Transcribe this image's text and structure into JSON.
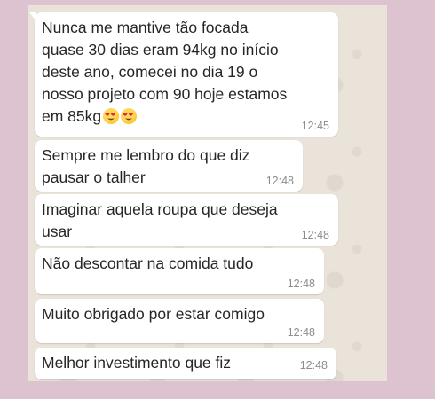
{
  "background_color": "#dcc3cf",
  "chat_background": "#e9e3d9",
  "bubble_color": "#ffffff",
  "messages": [
    {
      "lines": [
        "Nunca me mantive tão focada",
        "quase 30 dias eram 94kg no início",
        "deste ano, comecei no dia 19 o",
        "nosso projeto com 90 hoje estamos",
        "em 85kg"
      ],
      "emoji": [
        "heart-eyes-emoji",
        "heart-eyes-emoji"
      ],
      "time": "12:45"
    },
    {
      "lines": [
        "Sempre me lembro do que diz",
        "pausar o talher"
      ],
      "time": "12:48"
    },
    {
      "lines": [
        "Imaginar aquela roupa que deseja",
        "usar"
      ],
      "time": "12:48"
    },
    {
      "lines": [
        "Não descontar na comida tudo"
      ],
      "time": "12:48"
    },
    {
      "lines": [
        "Muito obrigado por estar comigo"
      ],
      "time": "12:48"
    },
    {
      "lines": [
        "Melhor investimento que fiz"
      ],
      "time": "12:48"
    }
  ]
}
